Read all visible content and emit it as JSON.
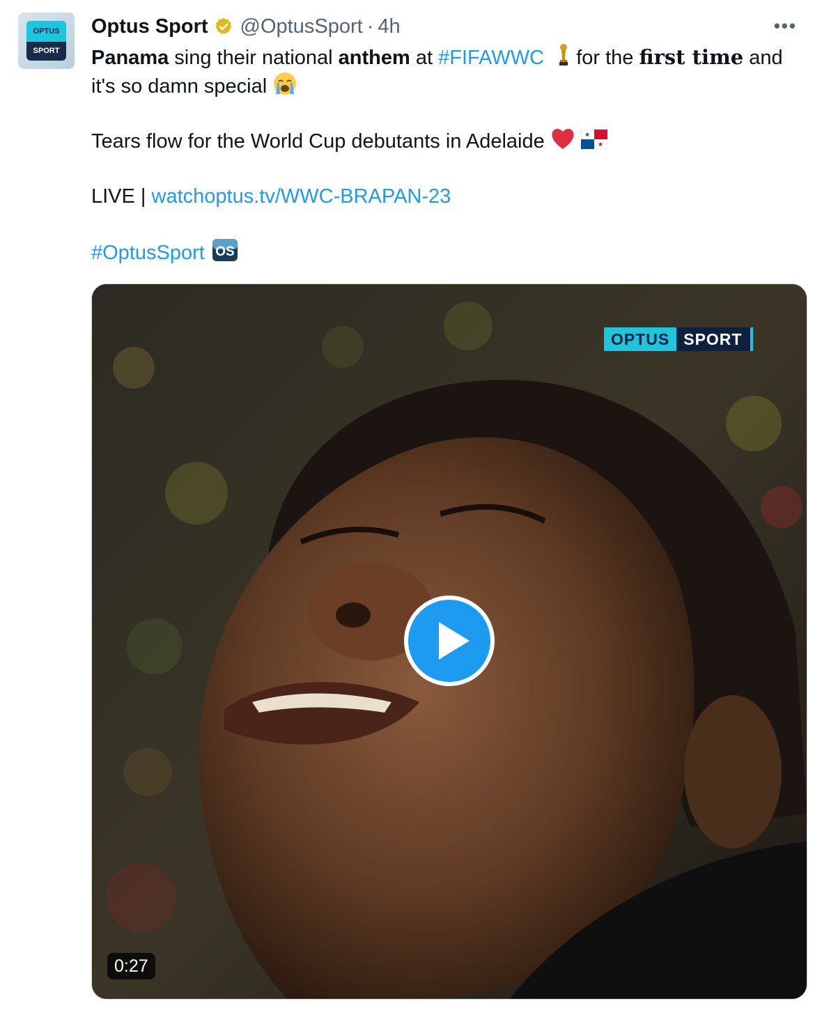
{
  "account": {
    "avatar_top": "OPTUS",
    "avatar_bottom": "SPORT",
    "name": "Optus Sport",
    "handle": "@OptusSport",
    "separator": "·",
    "time": "4h",
    "more": "•••"
  },
  "tweet": {
    "l1_b1": "Panama",
    "l1_t1": " sing their national ",
    "l1_b2": "anthem",
    "l1_t2": " at ",
    "l1_link": "#FIFAWWC",
    "l1_t3": " for the ",
    "l1_serif": "first time",
    "l1_t4": " and",
    "l2_text": "it's so damn special",
    "l3_text": "Tears flow for the World Cup debutants in Adelaide",
    "l4_prefix": "LIVE | ",
    "l4_link": "watchoptus.tv/WWC-BRAPAN-23",
    "l5_link": "#OptusSport",
    "os_badge": "OS"
  },
  "media": {
    "logo_left": "OPTUS",
    "logo_right": "SPORT",
    "duration": "0:27"
  },
  "colors": {
    "link": "#1d9bf0",
    "secondary_text": "#536471",
    "play_button": "#1d9bf0",
    "brand_cyan": "#1ec6dd",
    "brand_navy": "#0d2040"
  },
  "icons": [
    "verified-badge-icon",
    "more-icon",
    "trophy-emoji",
    "crying-face-emoji",
    "red-heart-emoji",
    "panama-flag-emoji",
    "play-icon"
  ]
}
